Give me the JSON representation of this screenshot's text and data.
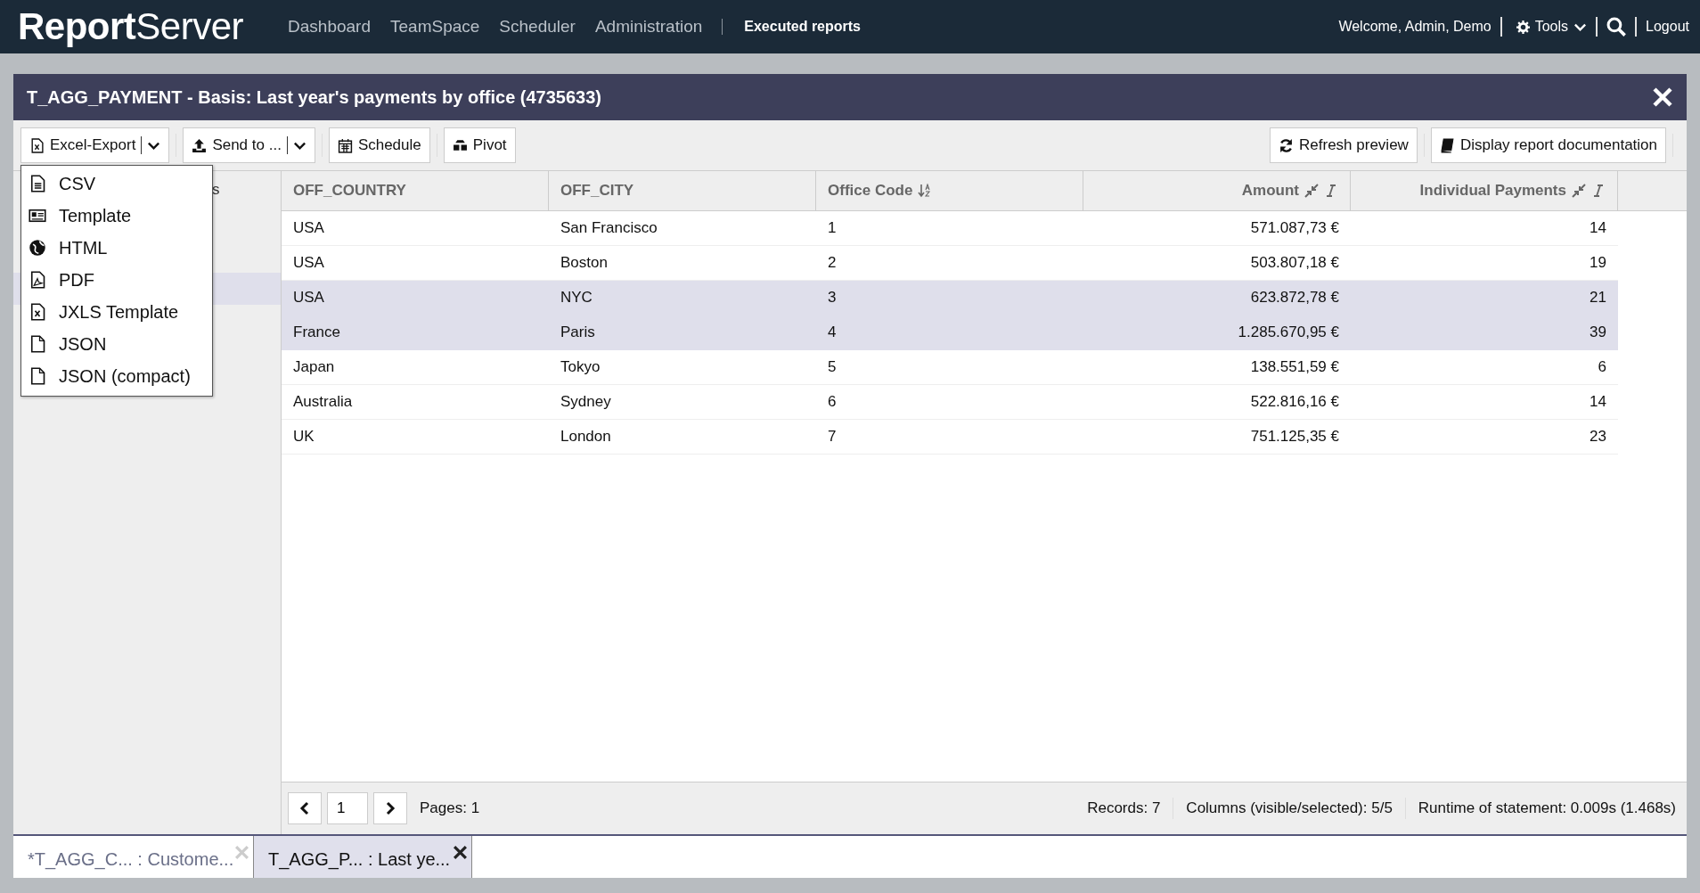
{
  "top_bar": {
    "logo": {
      "bold": "Report",
      "light": "Server"
    },
    "nav": [
      {
        "label": "Dashboard",
        "selected": false
      },
      {
        "label": "TeamSpace",
        "selected": false
      },
      {
        "label": "Scheduler",
        "selected": false
      },
      {
        "label": "Administration",
        "selected": false
      },
      {
        "label": "Executed reports",
        "selected": true
      }
    ],
    "welcome": "Welcome, Admin, Demo",
    "tools": "Tools",
    "logout": "Logout"
  },
  "window": {
    "title": "T_AGG_PAYMENT - Basis: Last year's payments by office (4735633)"
  },
  "toolbar": {
    "left": [
      {
        "label": "Excel-Export",
        "kind": "split"
      },
      {
        "label": "Send to ...",
        "kind": "split"
      },
      {
        "label": "Schedule",
        "kind": "plain"
      },
      {
        "label": "Pivot",
        "kind": "plain"
      }
    ],
    "right": [
      {
        "label": "Refresh preview",
        "kind": "plain"
      },
      {
        "label": "Display report documentation",
        "kind": "plain"
      }
    ]
  },
  "export_menu": [
    {
      "label": "CSV"
    },
    {
      "label": "Template"
    },
    {
      "label": "HTML"
    },
    {
      "label": "PDF"
    },
    {
      "label": "JXLS Template"
    },
    {
      "label": "JSON"
    },
    {
      "label": "JSON (compact)"
    }
  ],
  "sidebar": {
    "heading": "s",
    "items": [
      {
        "selected": false
      },
      {
        "selected": false
      },
      {
        "selected": true
      }
    ]
  },
  "table": {
    "columns": [
      {
        "label": "OFF_COUNTRY"
      },
      {
        "label": "OFF_CITY"
      },
      {
        "label": "Office Code"
      },
      {
        "label": "Amount"
      },
      {
        "label": "Individual Payments"
      }
    ],
    "rows": [
      {
        "cells": [
          "USA",
          "San Francisco",
          "1",
          "571.087,73 €",
          "14"
        ],
        "selected": false
      },
      {
        "cells": [
          "USA",
          "Boston",
          "2",
          "503.807,18 €",
          "19"
        ],
        "selected": false
      },
      {
        "cells": [
          "USA",
          "NYC",
          "3",
          "623.872,78 €",
          "21"
        ],
        "selected": true
      },
      {
        "cells": [
          "France",
          "Paris",
          "4",
          "1.285.670,95 €",
          "39"
        ],
        "selected": true
      },
      {
        "cells": [
          "Japan",
          "Tokyo",
          "5",
          "138.551,59 €",
          "6"
        ],
        "selected": false
      },
      {
        "cells": [
          "Australia",
          "Sydney",
          "6",
          "522.816,16 €",
          "14"
        ],
        "selected": false
      },
      {
        "cells": [
          "UK",
          "London",
          "7",
          "751.125,35 €",
          "23"
        ],
        "selected": false
      }
    ]
  },
  "pager": {
    "page": "1",
    "pages": "Pages: 1"
  },
  "status": [
    "Records: 7",
    "Columns (visible/selected): 5/5",
    "Runtime of statement: 0.009s (1.468s)"
  ],
  "tabs": [
    {
      "label": "*T_AGG_C... : Custome...",
      "selected": false
    },
    {
      "label": "T_AGG_P... : Last ye...",
      "selected": true
    }
  ]
}
